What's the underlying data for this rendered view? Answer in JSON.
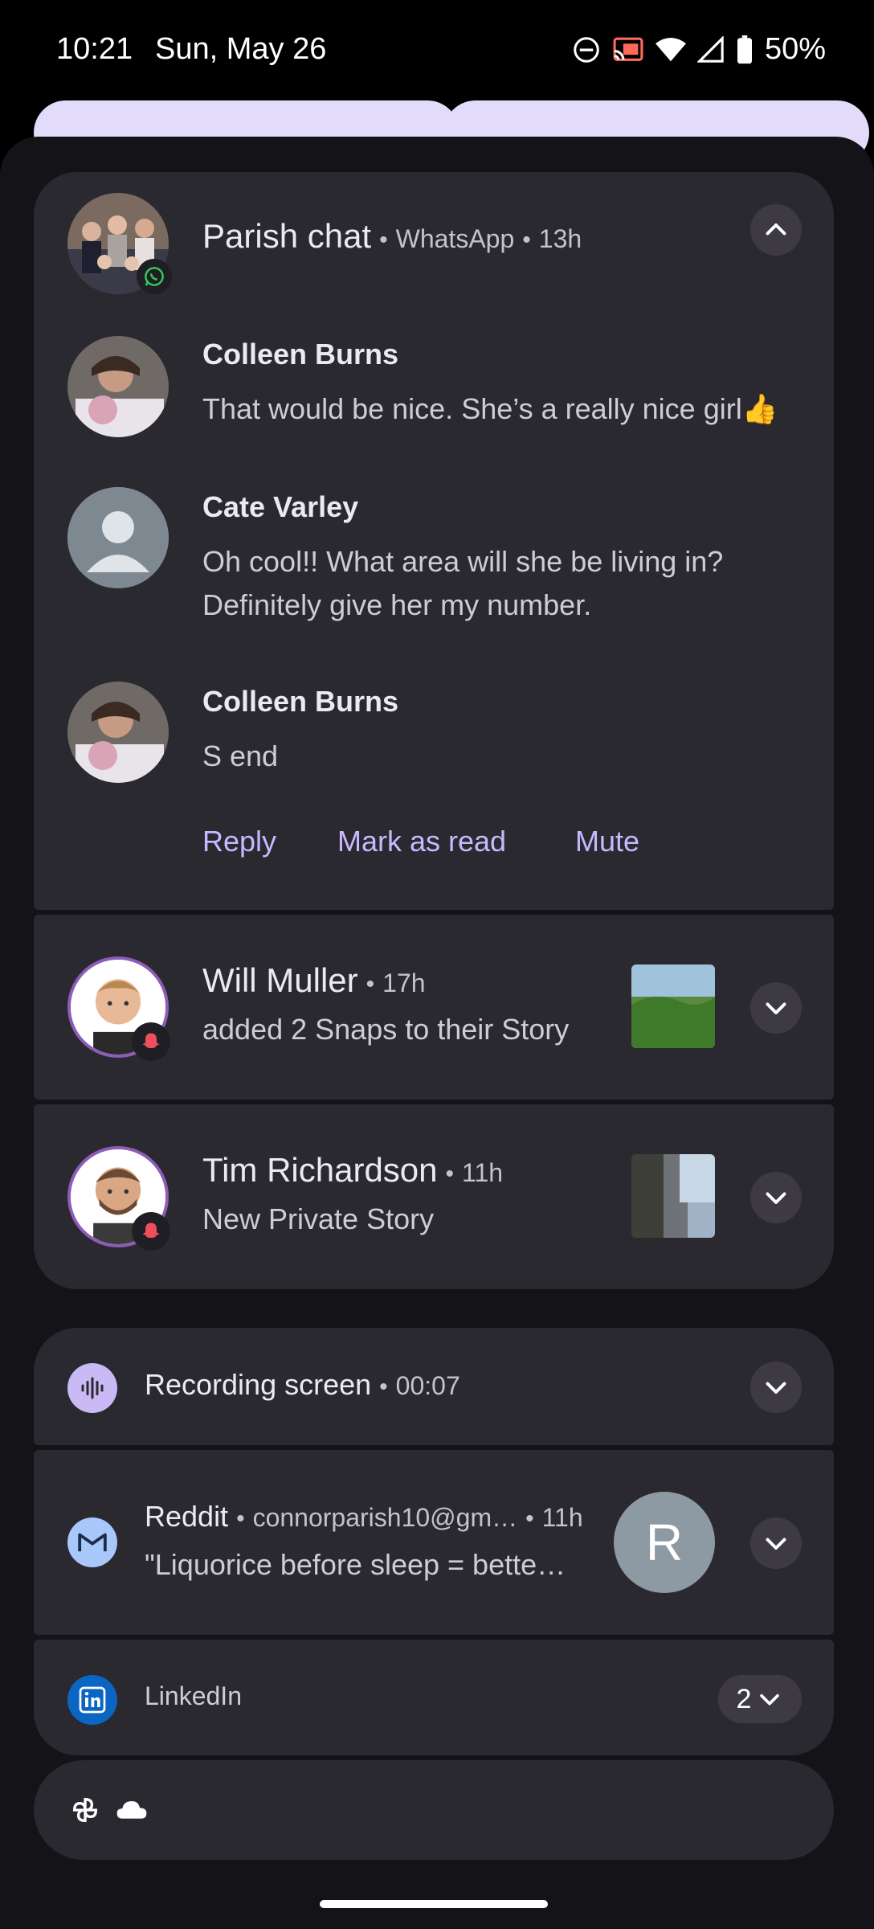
{
  "status_bar": {
    "time": "10:21",
    "date": "Sun, May 26",
    "battery": "50%",
    "icons": [
      "do-not-disturb-icon",
      "cast-icon",
      "wifi-icon",
      "signal-icon",
      "battery-icon"
    ]
  },
  "whatsapp": {
    "group_name": "Parish chat",
    "app": "WhatsApp",
    "time": "13h",
    "messages": [
      {
        "sender": "Colleen Burns",
        "text": "That would be nice. She’s a really nice girl👍"
      },
      {
        "sender": "Cate Varley",
        "text_line1": "Oh cool!! What area will she be living in?",
        "text_line2": "Definitely give her my number."
      },
      {
        "sender": "Colleen Burns",
        "text": "S end"
      }
    ],
    "actions": {
      "reply": "Reply",
      "mark_read": "Mark as read",
      "mute": "Mute"
    }
  },
  "snap1": {
    "name": "Will Muller",
    "time": "17h",
    "text": "added 2 Snaps to their Story"
  },
  "snap2": {
    "name": "Tim Richardson",
    "time": "11h",
    "text": "New Private Story"
  },
  "recording": {
    "title": "Recording screen",
    "time": "00:07"
  },
  "reddit": {
    "title": "Reddit",
    "account": "connorparish10@gm…",
    "time": "11h",
    "text": "\"Liquorice before sleep = bette…",
    "avatar_letter": "R"
  },
  "linkedin": {
    "title": "LinkedIn",
    "count": "2"
  },
  "colors": {
    "accent": "#c8b8ff",
    "card": "#2b2930",
    "shade": "#141318"
  }
}
